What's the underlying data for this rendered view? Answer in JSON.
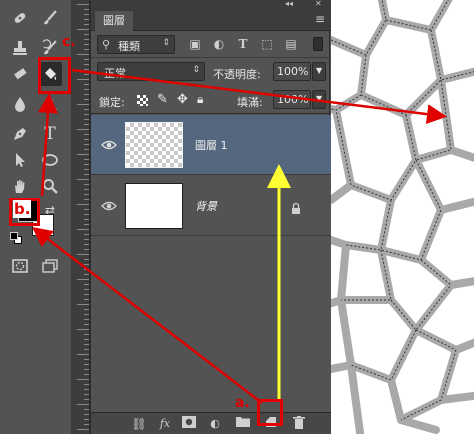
{
  "panel": {
    "tab_label": "圖層",
    "filter_kind": "種類",
    "blend_mode": "正常",
    "opacity_label": "不透明度:",
    "opacity_value": "100%",
    "lock_label": "鎖定:",
    "fill_label": "填滿:",
    "fill_value": "100%"
  },
  "layers": [
    {
      "name": "圖層 1",
      "selected": true,
      "thumbnail": "transparent"
    },
    {
      "name": "背景",
      "selected": false,
      "thumbnail": "white",
      "locked": true
    }
  ],
  "annotations": {
    "label_a": "a.",
    "label_b": "b.",
    "label_c": "c.",
    "color_red": "#e00000",
    "color_yellow": "#ffff33"
  },
  "colors": {
    "panel_bg": "#535353",
    "selected_layer": "#55677f",
    "foreground_swatch": "#000000",
    "background_swatch": "#ffffff"
  },
  "icons": {
    "toolbar": [
      "spot-healing-icon",
      "brush-icon",
      "clone-stamp-icon",
      "history-brush-icon",
      "eraser-icon",
      "paint-bucket-icon",
      "blur-icon",
      "dodge-icon",
      "pen-icon",
      "type-icon",
      "path-select-icon",
      "ellipse-icon",
      "hand-icon",
      "zoom-icon",
      "default-colors-icon",
      "swap-colors-icon",
      "quick-mask-icon",
      "screen-mode-icon"
    ],
    "bottom_bar": [
      "link-icon",
      "fx-icon",
      "mask-icon",
      "adjustment-icon",
      "folder-icon",
      "new-layer-icon",
      "trash-icon"
    ]
  }
}
